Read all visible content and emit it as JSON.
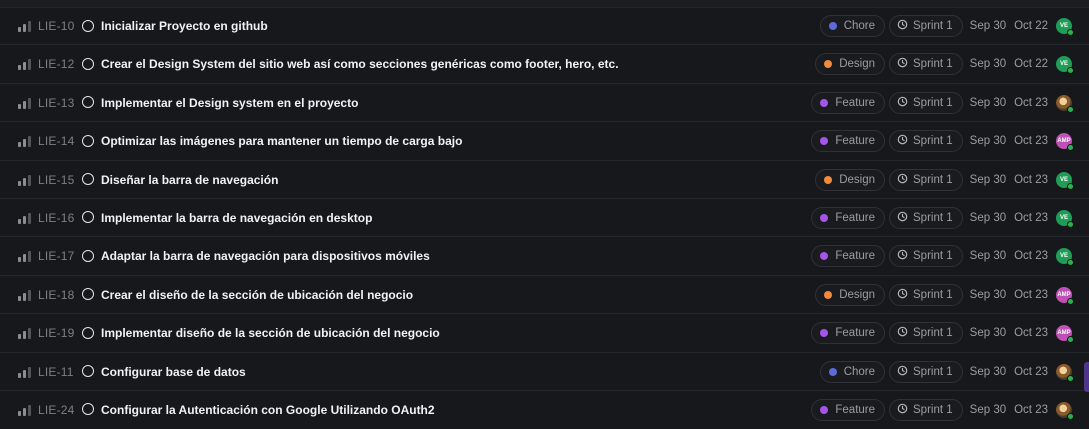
{
  "colors": {
    "chore": "#5b6bdb",
    "design": "#f08a3c",
    "feature": "#a454e8",
    "avatar_ve": "#1f9d57",
    "avatar_amp": "#c24fb6",
    "status_online": "#2bb24c"
  },
  "icons": {
    "priority": "priority-bars-icon",
    "status": "circle-todo-icon",
    "sprint": "sprint-cycle-icon"
  },
  "issues": [
    {
      "id": "LIE-10",
      "title": "Inicializar Proyecto en github",
      "label": "Chore",
      "label_type": "chore",
      "sprint": "Sprint 1",
      "start": "Sep 30",
      "due": "Oct 22",
      "assignee": "VE",
      "assignee_type": "ve"
    },
    {
      "id": "LIE-12",
      "title": "Crear el Design System del sitio web así como secciones genéricas como footer, hero, etc.",
      "label": "Design",
      "label_type": "design",
      "sprint": "Sprint 1",
      "start": "Sep 30",
      "due": "Oct 22",
      "assignee": "VE",
      "assignee_type": "ve"
    },
    {
      "id": "LIE-13",
      "title": "Implementar el Design system en el proyecto",
      "label": "Feature",
      "label_type": "feature",
      "sprint": "Sprint 1",
      "start": "Sep 30",
      "due": "Oct 23",
      "assignee": "",
      "assignee_type": "img"
    },
    {
      "id": "LIE-14",
      "title": "Optimizar las imágenes para mantener un tiempo de carga bajo",
      "label": "Feature",
      "label_type": "feature",
      "sprint": "Sprint 1",
      "start": "Sep 30",
      "due": "Oct 23",
      "assignee": "AMP",
      "assignee_type": "amp"
    },
    {
      "id": "LIE-15",
      "title": "Diseñar la barra de navegación",
      "label": "Design",
      "label_type": "design",
      "sprint": "Sprint 1",
      "start": "Sep 30",
      "due": "Oct 23",
      "assignee": "VE",
      "assignee_type": "ve"
    },
    {
      "id": "LIE-16",
      "title": "Implementar la barra de navegación en desktop",
      "label": "Feature",
      "label_type": "feature",
      "sprint": "Sprint 1",
      "start": "Sep 30",
      "due": "Oct 23",
      "assignee": "VE",
      "assignee_type": "ve"
    },
    {
      "id": "LIE-17",
      "title": "Adaptar la barra de navegación para dispositivos móviles",
      "label": "Feature",
      "label_type": "feature",
      "sprint": "Sprint 1",
      "start": "Sep 30",
      "due": "Oct 23",
      "assignee": "VE",
      "assignee_type": "ve"
    },
    {
      "id": "LIE-18",
      "title": "Crear el diseño de la sección de ubicación del negocio",
      "label": "Design",
      "label_type": "design",
      "sprint": "Sprint 1",
      "start": "Sep 30",
      "due": "Oct 23",
      "assignee": "AMP",
      "assignee_type": "amp"
    },
    {
      "id": "LIE-19",
      "title": "Implementar diseño de la sección de ubicación del negocio",
      "label": "Feature",
      "label_type": "feature",
      "sprint": "Sprint 1",
      "start": "Sep 30",
      "due": "Oct 23",
      "assignee": "AMP",
      "assignee_type": "amp"
    },
    {
      "id": "LIE-11",
      "title": "Configurar base de datos",
      "label": "Chore",
      "label_type": "chore",
      "sprint": "Sprint 1",
      "start": "Sep 30",
      "due": "Oct 23",
      "assignee": "",
      "assignee_type": "img"
    },
    {
      "id": "LIE-24",
      "title": "Configurar la Autenticación con Google Utilizando OAuth2",
      "label": "Feature",
      "label_type": "feature",
      "sprint": "Sprint 1",
      "start": "Sep 30",
      "due": "Oct 23",
      "assignee": "",
      "assignee_type": "img"
    }
  ]
}
